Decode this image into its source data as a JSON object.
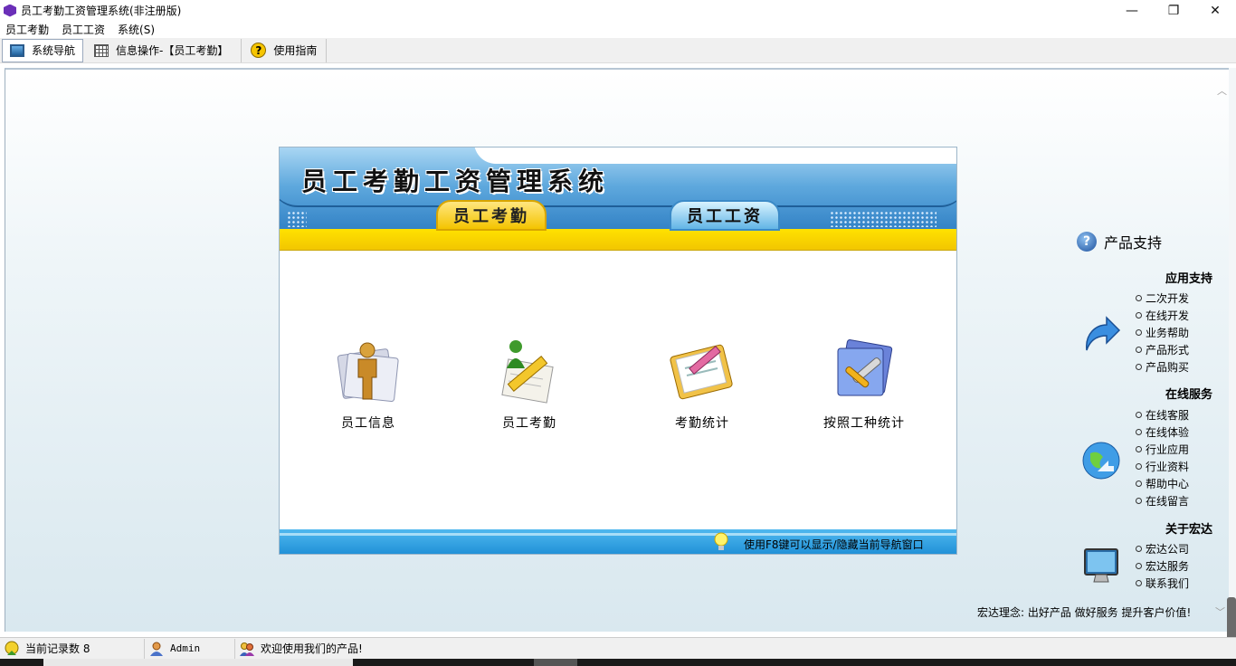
{
  "window": {
    "title": "员工考勤工资管理系统(非注册版)",
    "minimize": "—",
    "restore": "❐",
    "close": "✕"
  },
  "menu": [
    "员工考勤",
    "员工工资",
    "系统(S)"
  ],
  "toolbar": {
    "tabs": [
      {
        "label": "系统导航",
        "icon": "monitor-icon"
      },
      {
        "label": "信息操作-【员工考勤】",
        "icon": "grid-icon"
      },
      {
        "label": "使用指南",
        "icon": "help-icon"
      }
    ]
  },
  "nav_panel": {
    "banner_title": "员工考勤工资管理系统",
    "tabs": [
      {
        "label": "员工考勤",
        "active": true
      },
      {
        "label": "员工工资",
        "active": false
      }
    ],
    "items": [
      {
        "label": "员工信息",
        "icon": "person-icon"
      },
      {
        "label": "员工考勤",
        "icon": "attendance-edit-icon"
      },
      {
        "label": "考勤统计",
        "icon": "clipboard-icon"
      },
      {
        "label": "按照工种统计",
        "icon": "tools-icon"
      }
    ],
    "footer_tip": "使用F8键可以显示/隐藏当前导航窗口"
  },
  "support": {
    "title": "产品支持",
    "sections": [
      {
        "title": "应用支持",
        "icon": "arrow-icon",
        "links": [
          "二次开发",
          "在线开发",
          "业务帮助",
          "产品形式",
          "产品购买"
        ]
      },
      {
        "title": "在线服务",
        "icon": "globe-icon",
        "links": [
          "在线客服",
          "在线体验",
          "行业应用",
          "行业资料",
          "帮助中心",
          "在线留言"
        ]
      },
      {
        "title": "关于宏达",
        "icon": "monitor-icon",
        "links": [
          "宏达公司",
          "宏达服务",
          "联系我们"
        ]
      }
    ],
    "motto": "宏达理念: 出好产品  做好服务  提升客户价值!"
  },
  "status": {
    "records_label": "当前记录数 8",
    "user": "Admin",
    "welcome": "欢迎使用我们的产品!"
  },
  "colors": {
    "banner_blue": "#2f7fc4",
    "tab_yellow": "#f4c400",
    "footer_blue": "#1e8fd6"
  }
}
